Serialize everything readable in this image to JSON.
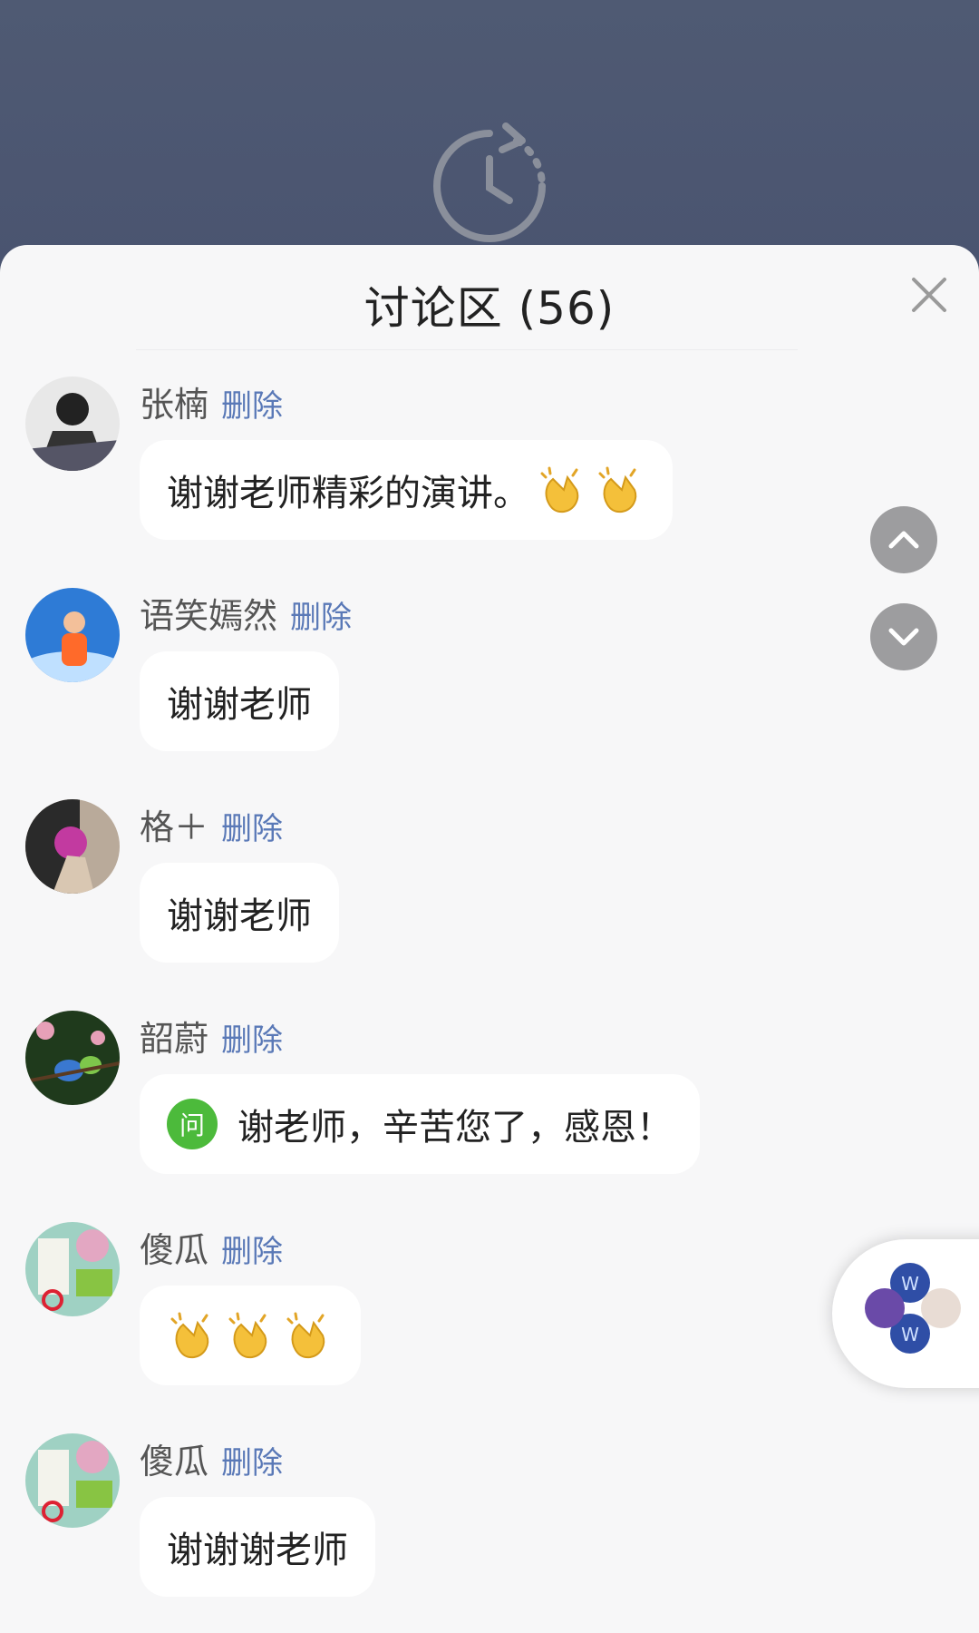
{
  "header": {
    "title": "讨论区 (56)"
  },
  "messages": [
    {
      "author": "张楠",
      "delete_label": "删除",
      "text": "谢谢老师精彩的演讲。",
      "claps": 2
    },
    {
      "author": "语笑嫣然",
      "delete_label": "删除",
      "text": "谢谢老师",
      "claps": 0
    },
    {
      "author": "格＋",
      "delete_label": "删除",
      "text": "谢谢老师",
      "claps": 0
    },
    {
      "author": "韶蔚",
      "delete_label": "删除",
      "badge": "问",
      "text": "谢老师，辛苦您了，感恩！",
      "claps": 0
    },
    {
      "author": "傻瓜",
      "delete_label": "删除",
      "text": "",
      "claps": 3
    },
    {
      "author": "傻瓜",
      "delete_label": "删除",
      "text": "谢谢谢老师",
      "claps": 0
    }
  ],
  "colors": {
    "accent_link": "#5a79b7",
    "badge_green": "#4cba3b",
    "header_bg": "#4e5872"
  },
  "icons": [
    "history-clock-icon",
    "close-icon",
    "chevron-up-icon",
    "chevron-down-icon",
    "clap-emoji-icon",
    "floating-app-icon"
  ]
}
